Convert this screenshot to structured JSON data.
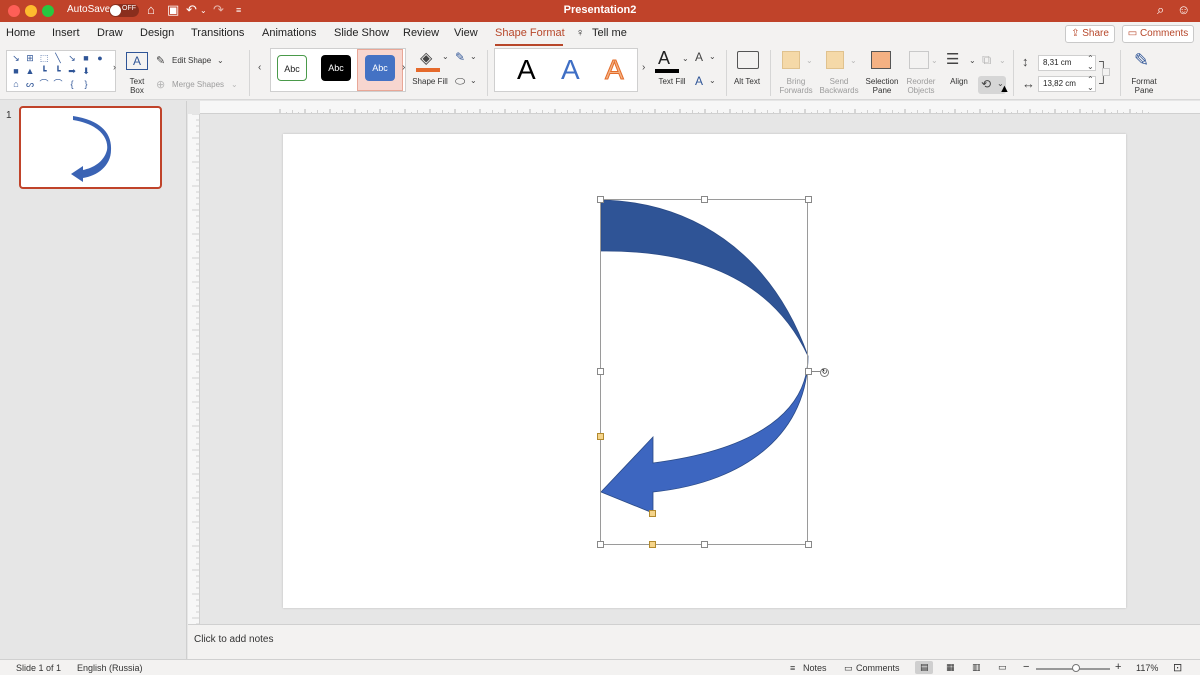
{
  "titlebar": {
    "autosave_label": "AutoSave",
    "autosave_state": "OFF",
    "document_title": "Presentation2"
  },
  "tabs": [
    {
      "label": "Home"
    },
    {
      "label": "Insert"
    },
    {
      "label": "Draw"
    },
    {
      "label": "Design"
    },
    {
      "label": "Transitions"
    },
    {
      "label": "Animations"
    },
    {
      "label": "Slide Show"
    },
    {
      "label": "Review"
    },
    {
      "label": "View"
    },
    {
      "label": "Shape Format"
    },
    {
      "label": "Tell me"
    }
  ],
  "header_buttons": {
    "share": "Share",
    "comments": "Comments"
  },
  "ribbon": {
    "text_box": "Text Box",
    "edit_shape": "Edit Shape",
    "merge_shapes": "Merge Shapes",
    "style_abc": "Abc",
    "shape_fill": "Shape Fill",
    "wordart_letter": "A",
    "text_fill": "Text Fill",
    "alt_text": "Alt Text",
    "bring_forwards": "Bring Forwards",
    "send_backwards": "Send Backwards",
    "selection_pane": "Selection Pane",
    "reorder_objects": "Reorder Objects",
    "align": "Align",
    "height_value": "8,31 cm",
    "width_value": "13,82 cm",
    "format_pane": "Format Pane"
  },
  "thumbnails": [
    {
      "number": "1"
    }
  ],
  "notes": {
    "placeholder": "Click to add notes"
  },
  "statusbar": {
    "slide_info": "Slide 1 of 1",
    "language": "English (Russia)",
    "notes": "Notes",
    "comments": "Comments",
    "zoom_minus": "−",
    "zoom_plus": "+",
    "zoom_level": "117%"
  },
  "colors": {
    "titlebar": "#c0432a",
    "accent": "#b7472a",
    "arrow_dark": "#2f5496",
    "arrow_light": "#4472c4"
  },
  "icons": {
    "home": "home-icon",
    "save": "save-icon",
    "undo": "undo-icon",
    "redo": "redo-icon",
    "search": "search-icon",
    "person": "person-icon"
  }
}
